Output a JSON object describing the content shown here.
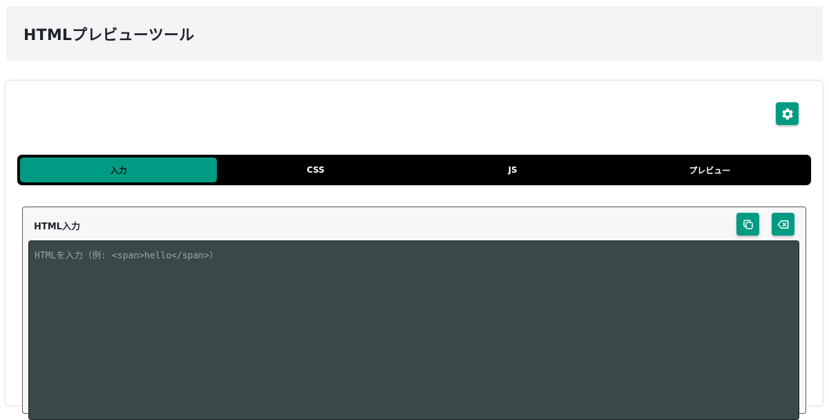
{
  "header": {
    "title": "HTMLプレビューツール"
  },
  "settings": {
    "icon": "gear-icon"
  },
  "tabs": [
    {
      "label": "入力",
      "active": true
    },
    {
      "label": "CSS",
      "active": false
    },
    {
      "label": "JS",
      "active": false
    },
    {
      "label": "プレビュー",
      "active": false
    }
  ],
  "panel": {
    "title": "HTML入力",
    "copy_icon": "copy-icon",
    "clear_icon": "backspace-icon",
    "editor": {
      "value": "",
      "placeholder": "HTMLを入力（例: <span>hello</span>）"
    }
  },
  "colors": {
    "accent": "#009b82",
    "tab_bar": "#000000",
    "editor_bg": "#394849",
    "header_bg": "#f3f4f6"
  }
}
